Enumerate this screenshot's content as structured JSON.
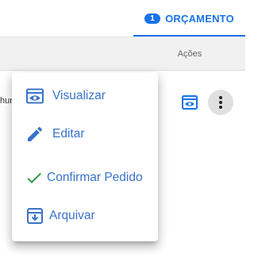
{
  "tab": {
    "count": "1",
    "label": "ORÇAMENTO"
  },
  "table": {
    "header_actions": "Ações",
    "row_partial_text": "hur"
  },
  "menu": {
    "items": [
      {
        "label": "Visualizar",
        "icon": "eye-icon"
      },
      {
        "label": "Editar",
        "icon": "pencil-icon"
      },
      {
        "label": "Confirmar Pedido",
        "icon": "check-icon"
      },
      {
        "label": "Arquivar",
        "icon": "archive-icon"
      }
    ]
  },
  "colors": {
    "accent": "#1a73e8",
    "menu_text": "#3b73c9",
    "check": "#2e9b44"
  }
}
